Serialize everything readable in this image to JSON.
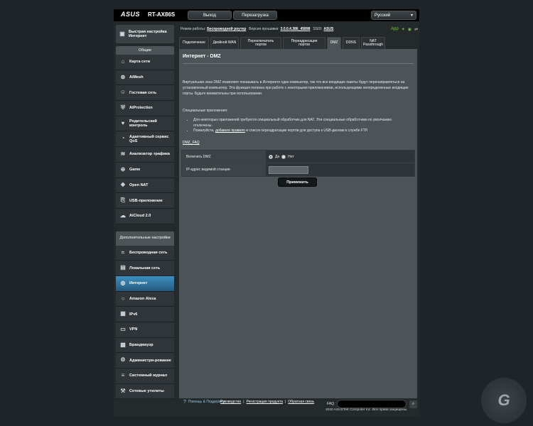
{
  "header": {
    "brand": "ASUS",
    "model": "RT-AX86S",
    "logout_label": "Выход",
    "reboot_label": "Перезагрузка",
    "language": "Русский"
  },
  "status": {
    "mode_label": "Режим работы:",
    "mode_value": "Беспроводной роутер",
    "firmware_label": "Версия прошивки:",
    "firmware_value": "3.0.0.4.386_45898",
    "ssid_label": "SSID:",
    "ssid_value": "ASUS",
    "app_label": "App"
  },
  "nav": {
    "quick_setup": "Быстрая настройка Интернет",
    "general_header": "Общие",
    "general_items": [
      {
        "label": "Карта сети",
        "icon": "network-map-icon"
      },
      {
        "label": "AiMesh",
        "icon": "aimesh-icon"
      },
      {
        "label": "Гостевая сеть",
        "icon": "guest-network-icon"
      },
      {
        "label": "AiProtection",
        "icon": "shield-icon"
      },
      {
        "label": "Родительский контроль",
        "icon": "parental-control-icon"
      },
      {
        "label": "Адаптивный сервис QoS",
        "icon": "qos-icon"
      },
      {
        "label": "Анализатор трафика",
        "icon": "traffic-analyzer-icon"
      },
      {
        "label": "Game",
        "icon": "gamepad-icon"
      },
      {
        "label": "Open NAT",
        "icon": "open-nat-icon"
      },
      {
        "label": "USB-приложение",
        "icon": "usb-icon"
      },
      {
        "label": "AiCloud 2.0",
        "icon": "cloud-icon"
      }
    ],
    "advanced_header": "Дополнительные настройки",
    "advanced_items": [
      {
        "label": "Беспроводная сеть",
        "icon": "wireless-icon"
      },
      {
        "label": "Локальная сеть",
        "icon": "lan-icon"
      },
      {
        "label": "Интернет",
        "icon": "globe-icon",
        "active": true
      },
      {
        "label": "Amazon Alexa",
        "icon": "alexa-icon"
      },
      {
        "label": "IPv6",
        "icon": "ipv6-icon"
      },
      {
        "label": "VPN",
        "icon": "vpn-icon"
      },
      {
        "label": "Брандмауэр",
        "icon": "firewall-icon"
      },
      {
        "label": "Администри-рование",
        "icon": "admin-icon"
      },
      {
        "label": "Системный журнал",
        "icon": "system-log-icon"
      },
      {
        "label": "Сетевые утилиты",
        "icon": "network-tools-icon"
      }
    ]
  },
  "tabs": [
    {
      "label": "Подключение",
      "active": false
    },
    {
      "label": "Двойной WAN",
      "active": false
    },
    {
      "label": "Переключатель портов",
      "active": false
    },
    {
      "label": "Переадресация портов",
      "active": false
    },
    {
      "label": "DMZ",
      "active": true
    },
    {
      "label": "DDNS",
      "active": false
    },
    {
      "label": "NAT Passthrough",
      "active": false
    }
  ],
  "content": {
    "title": "Интернет - DMZ",
    "description": "Виртуальная зона DMZ позволяет показывать в Интернете один компьютер, так что все входящие пакеты будут перенаправляться на установленный компьютер. Эта функция полезна при работе с некоторыми приложениями, использующими неопределенные входящие порты. Будьте внимательны при использовании.",
    "special_title": "Специальные приложения:",
    "bullet1": "Для некоторых приложений требуется специальный обработчик для NAT. Эти специальные обработчики по умолчанию отключены.",
    "bullet2_pre": "Пожалуйста, ",
    "bullet2_link": "добавьте правило",
    "bullet2_post": " в список переадресации портов для доступа к USB-дискам в службе FTP.",
    "faq_link": "DMZ_FAQ",
    "enable_label": "Включить DMZ",
    "yes_label": "Да",
    "no_label": "Нет",
    "ip_label": "IP-адрес видимой станции",
    "ip_value": "",
    "apply_label": "Применить"
  },
  "footer": {
    "help_label": "Помощь & Поддержка",
    "manual": "Руководство",
    "register": "Регистрация продукта",
    "feedback": "Обратная связь",
    "faq_label": "FAQ",
    "copyright": "2020 ASUSTeK Computer Inc. Все права защищены."
  },
  "watermark": "G"
}
